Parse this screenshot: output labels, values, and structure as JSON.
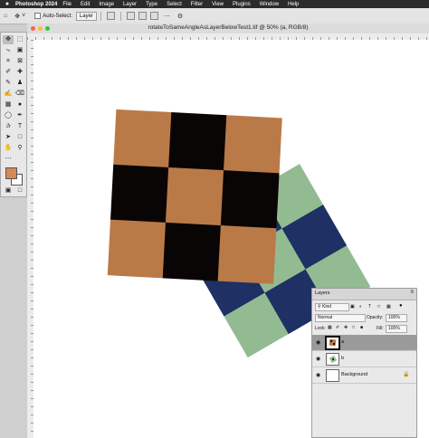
{
  "menubar": {
    "apple": "",
    "app_name": "Photoshop 2024",
    "items": [
      "File",
      "Edit",
      "Image",
      "Layer",
      "Type",
      "Select",
      "Filter",
      "View",
      "Plugins",
      "Window",
      "Help"
    ]
  },
  "options": {
    "auto_select_label": "Auto-Select:",
    "auto_select_target": "Layer"
  },
  "document": {
    "title": "rotateToSameAngleAsLayerBelowTest1.tif @ 50% (a, RGB/8)"
  },
  "colors": {
    "orange": "#BA7A48",
    "black": "#0A0505",
    "navy": "#1E3064",
    "green": "#93BB92",
    "foreground": "#D78955",
    "background": "#FFFFFF"
  },
  "layers_panel": {
    "tab": "Layers",
    "filter_kind": "Kind",
    "blend_mode": "Normal",
    "opacity_label": "Opacity:",
    "opacity_value": "100%",
    "lock_label": "Lock:",
    "fill_label": "Fill:",
    "fill_value": "100%",
    "layers": [
      {
        "name": "a",
        "selected": true
      },
      {
        "name": "b",
        "selected": false
      },
      {
        "name": "Background",
        "selected": false,
        "locked": true
      }
    ]
  }
}
